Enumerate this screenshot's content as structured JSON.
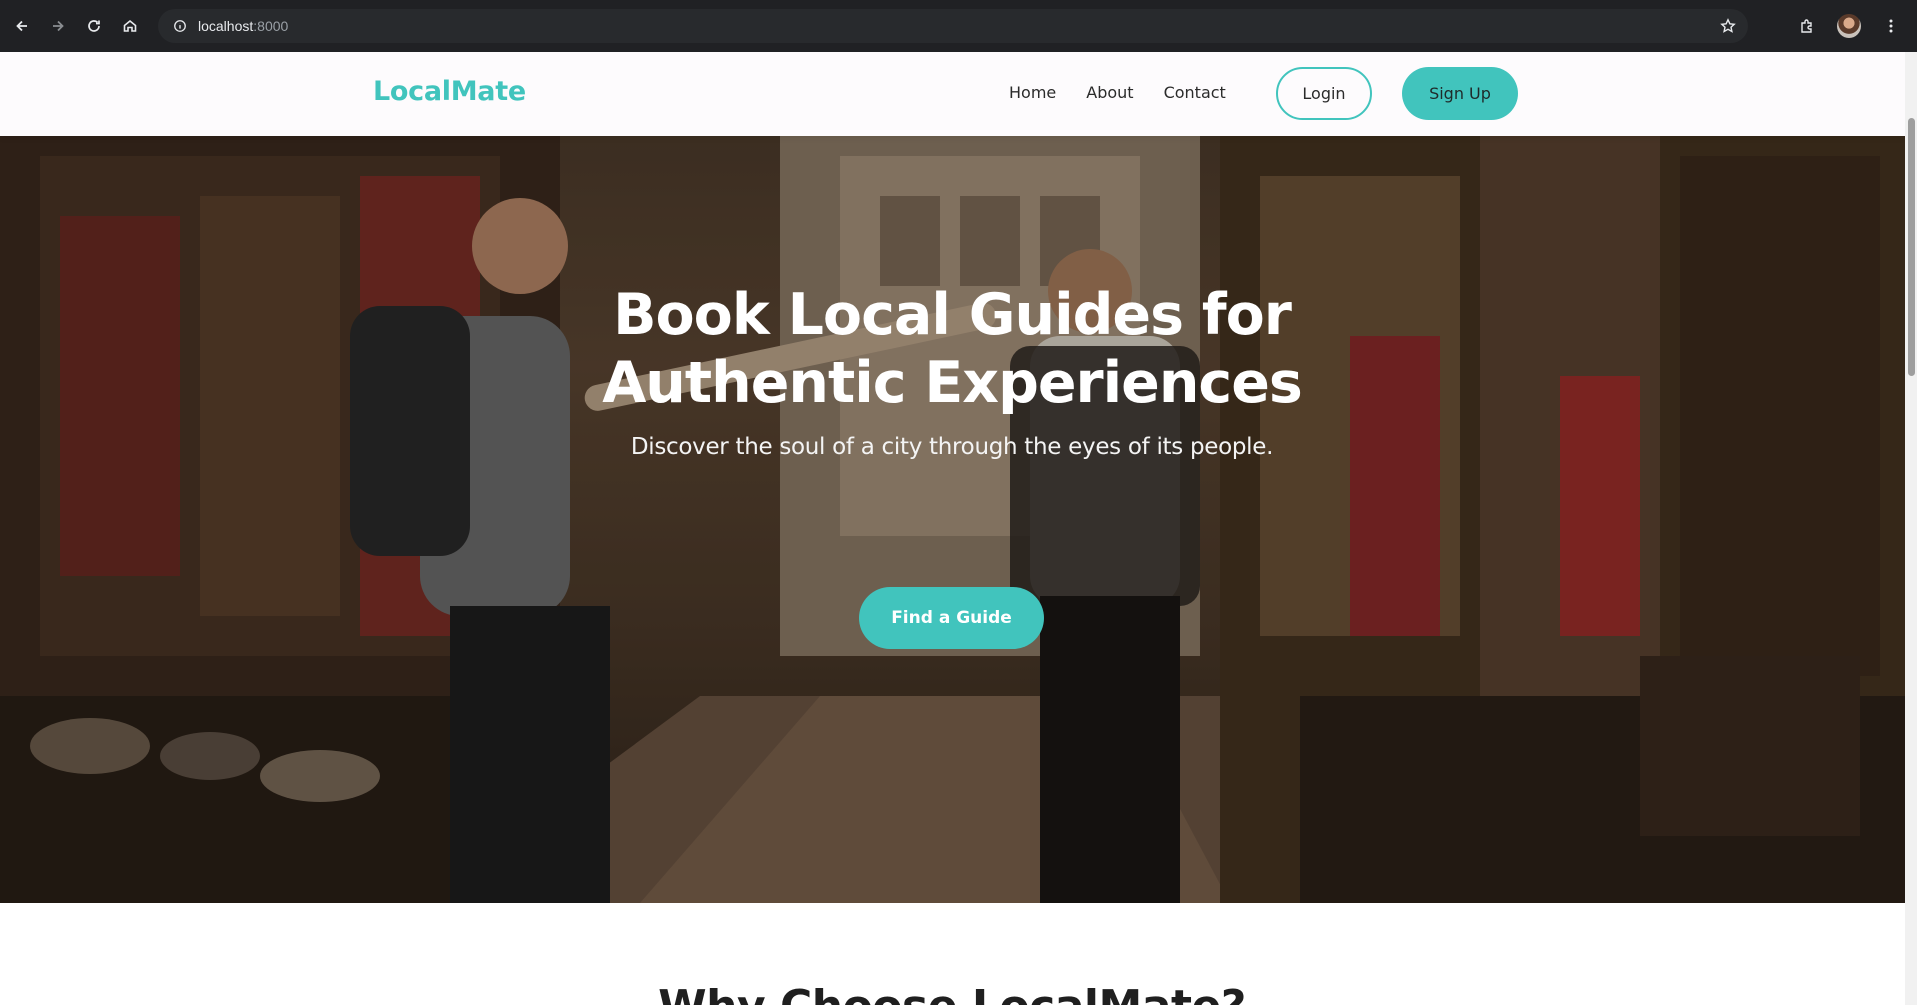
{
  "browser": {
    "url_host": "localhost",
    "url_port": ":8000"
  },
  "site": {
    "logo": "LocalMate",
    "nav": [
      {
        "label": "Home"
      },
      {
        "label": "About"
      },
      {
        "label": "Contact"
      }
    ],
    "login_label": "Login",
    "signup_label": "Sign Up",
    "accent_color": "#41c4bd"
  },
  "hero": {
    "title_line1": "Book Local Guides for",
    "title_line2": "Authentic Experiences",
    "subtitle": "Discover the soul of a city through the eyes of its people.",
    "cta_label": "Find a Guide"
  },
  "section": {
    "heading": "Why Choose LocalMate?"
  }
}
